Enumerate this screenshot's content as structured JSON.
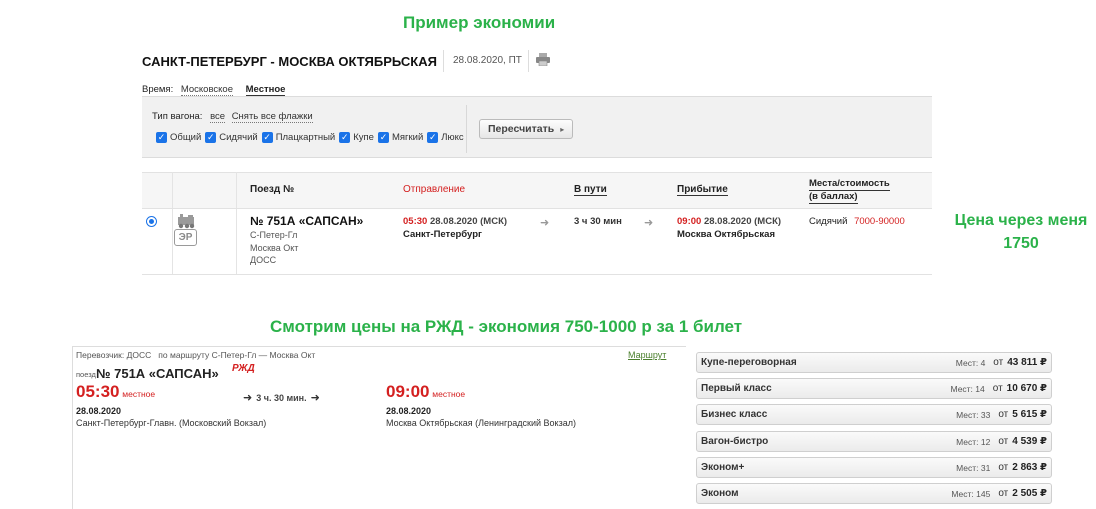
{
  "annotations": {
    "economy_example": "Пример экономии",
    "price_via_me": "Цена через меня 1750",
    "rzd_prices": "Смотрим цены на РЖД - экономия 750-1000 р за 1 билет"
  },
  "top_panel": {
    "route_title": "САНКТ-ПЕТЕРБУРГ - МОСКВА ОКТЯБРЬСКАЯ",
    "date": "28.08.2020, ПТ",
    "time_label": "Время:",
    "time_moscow": "Московское",
    "time_local": "Местное",
    "filter": {
      "wagon_type_label": "Тип вагона:",
      "all": "все",
      "clear_all": "Снять все флажки",
      "types": [
        "Общий",
        "Сидячий",
        "Плацкартный",
        "Купе",
        "Мягкий",
        "Люкс"
      ],
      "recalc_button": "Пересчитать"
    },
    "table": {
      "headers": {
        "train": "Поезд №",
        "departure": "Отправление",
        "duration": "В пути",
        "arrival": "Прибытие",
        "seats_line1": "Места/стоимость",
        "seats_line2": "(в баллах)"
      },
      "row": {
        "badge": "ЭР",
        "train_name": "№ 751А «САПСАН»",
        "route_lines": [
          "С-Петер-Гл",
          "Москва Окт",
          "ДОСС"
        ],
        "dep_time": "05:30",
        "dep_date": "28.08.2020 (МСК)",
        "dep_station": "Санкт-Петербург",
        "duration": "3 ч 30 мин",
        "arr_time": "09:00",
        "arr_date": "28.08.2020 (МСК)",
        "arr_station": "Москва Октябрьская",
        "seat_type": "Сидячий",
        "seat_price": "7000-90000"
      }
    }
  },
  "bottom_panel": {
    "carrier": "Перевозчик: ДОСС   по маршруту С-Петер-Гл — Москва Окт",
    "route_link": "Маршрут",
    "train_label": "поезд",
    "train_name": "№ 751А «САПСАН»",
    "logo": "РЖД",
    "dep_time": "05:30",
    "dep_tz": "местное",
    "dep_date": "28.08.2020",
    "dep_station": "Санкт-Петербург-Главн. (Московский Вокзал)",
    "duration": "3 ч. 30 мин.",
    "arr_time": "09:00",
    "arr_tz": "местное",
    "arr_date": "28.08.2020",
    "arr_station": "Москва Октябрьская (Ленинградский Вокзал)",
    "classes": [
      {
        "name": "Купе-переговорная",
        "seats": "Мест: 4",
        "from": "от",
        "price": "43 811 ₽"
      },
      {
        "name": "Первый класс",
        "seats": "Мест: 14",
        "from": "от",
        "price": "10 670 ₽"
      },
      {
        "name": "Бизнес класс",
        "seats": "Мест: 33",
        "from": "от",
        "price": "5 615 ₽"
      },
      {
        "name": "Вагон-бистро",
        "seats": "Мест: 12",
        "from": "от",
        "price": "4 539 ₽"
      },
      {
        "name": "Эконом+",
        "seats": "Мест: 31",
        "from": "от",
        "price": "2 863 ₽"
      },
      {
        "name": "Эконом",
        "seats": "Мест: 145",
        "from": "от",
        "price": "2 505 ₽"
      }
    ]
  },
  "colors": {
    "annotation_green": "#2bb24a",
    "time_red": "#d42020",
    "checkbox_blue": "#1a73e8"
  }
}
